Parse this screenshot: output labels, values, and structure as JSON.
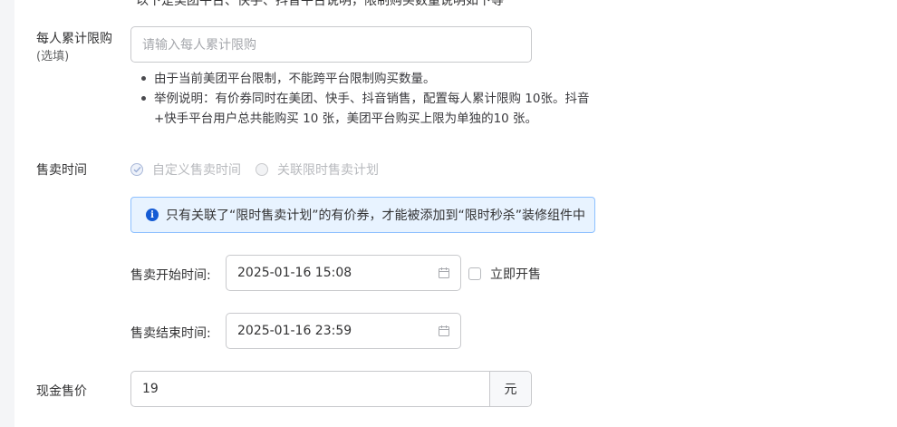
{
  "top_clipped_text": "以下是美团平台、快手、抖音平台说明，限制购买数量说明如下等",
  "limit": {
    "label": "每人累计限购",
    "sublabel": "(选填)",
    "placeholder": "请输入每人累计限购",
    "notes": [
      "由于当前美团平台限制，不能跨平台限制购买数量。",
      "举例说明：有价券同时在美团、快手、抖音销售，配置每人累计限购 10张。抖音+快手平台用户总共能购买 10 张，美团平台购买上限为单独的10 张。"
    ]
  },
  "sale_time": {
    "label": "售卖时间",
    "options": [
      {
        "label": "自定义售卖时间",
        "checked": true
      },
      {
        "label": "关联限时售卖计划",
        "checked": false
      }
    ],
    "alert": "只有关联了“限时售卖计划”的有价券，才能被添加到“限时秒杀”装修组件中",
    "start_label": "售卖开始时间:",
    "start_value": "2025-01-16 15:08",
    "immediate_label": "立即开售",
    "immediate_checked": false,
    "end_label": "售卖结束时间:",
    "end_value": "2025-01-16 23:59"
  },
  "price": {
    "label": "现金售价",
    "value": "19",
    "unit": "元"
  },
  "colors": {
    "primary": "#155bd4",
    "alert_bg": "#e8f3ff",
    "alert_border": "#8dc0ff",
    "border": "#c8c9cc"
  }
}
